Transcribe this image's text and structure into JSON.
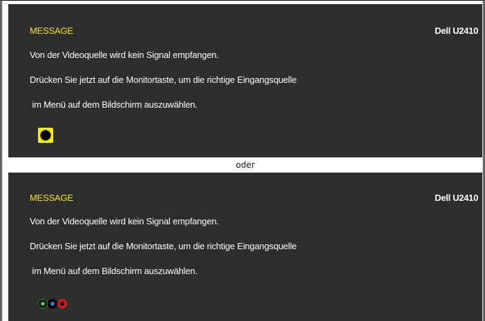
{
  "panels": [
    {
      "title": "MESSAGE",
      "model": "Dell U2410",
      "lines": [
        "Von der Videoquelle wird kein Signal empfangen.",
        "Drücken Sie jetzt auf die Monitortaste, um die richtige Eingangsquelle",
        " im Menü auf dem Bildschirm auszuwählen."
      ],
      "icon": "vga-connector-icon"
    },
    {
      "title": "MESSAGE",
      "model": "Dell U2410",
      "lines": [
        "Von der Videoquelle wird kein Signal empfangen.",
        "Drücken Sie jetzt auf die Monitortaste, um die richtige Eingangsquelle",
        " im Menü auf dem Bildschirm auszuwählen."
      ],
      "icon": "component-rgb-connector-icon"
    }
  ],
  "separator": "oder",
  "colors": {
    "panel_bg": "#2d2d2d",
    "title": "#f4e219",
    "text": "#ffffff"
  }
}
